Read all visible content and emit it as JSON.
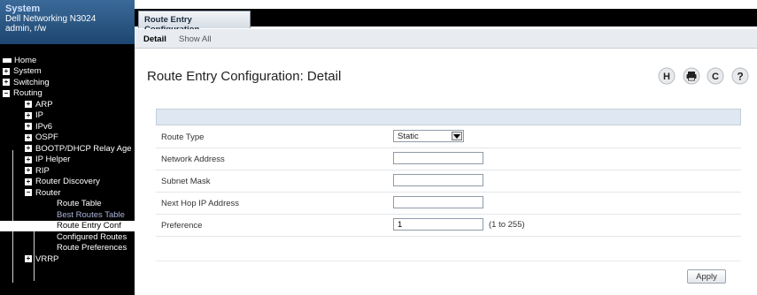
{
  "system": {
    "title": "System",
    "model": "Dell Networking N3024",
    "user": "admin, r/w"
  },
  "nav": {
    "items": [
      {
        "label": "Home",
        "toggle": "",
        "level": "lvl0",
        "icon": "home-icon",
        "state": ""
      },
      {
        "label": "System",
        "toggle": "+",
        "level": "lvl0",
        "icon": "expand-icon",
        "state": ""
      },
      {
        "label": "Switching",
        "toggle": "+",
        "level": "lvl0",
        "icon": "expand-icon",
        "state": ""
      },
      {
        "label": "Routing",
        "toggle": "−",
        "level": "lvl0",
        "icon": "collapse-icon",
        "state": ""
      },
      {
        "label": "ARP",
        "toggle": "+",
        "level": "lvl1",
        "icon": "expand-icon",
        "state": ""
      },
      {
        "label": "IP",
        "toggle": "+",
        "level": "lvl1",
        "icon": "expand-icon",
        "state": ""
      },
      {
        "label": "IPv6",
        "toggle": "+",
        "level": "lvl1",
        "icon": "expand-icon",
        "state": ""
      },
      {
        "label": "OSPF",
        "toggle": "+",
        "level": "lvl1",
        "icon": "expand-icon",
        "state": ""
      },
      {
        "label": "BOOTP/DHCP Relay Age",
        "toggle": "+",
        "level": "lvl1",
        "icon": "expand-icon",
        "state": ""
      },
      {
        "label": "IP Helper",
        "toggle": "+",
        "level": "lvl1",
        "icon": "expand-icon",
        "state": ""
      },
      {
        "label": "RIP",
        "toggle": "+",
        "level": "lvl1",
        "icon": "expand-icon",
        "state": ""
      },
      {
        "label": "Router Discovery",
        "toggle": "+",
        "level": "lvl1",
        "icon": "expand-icon",
        "state": ""
      },
      {
        "label": "Router",
        "toggle": "−",
        "level": "lvl1",
        "icon": "collapse-icon",
        "state": ""
      },
      {
        "label": "Route Table",
        "toggle": "",
        "level": "lvl2",
        "icon": "",
        "state": ""
      },
      {
        "label": "Best Routes Table",
        "toggle": "",
        "level": "lvl2",
        "icon": "",
        "state": "dim"
      },
      {
        "label": "Route Entry Conf",
        "toggle": "",
        "level": "lvl2",
        "icon": "",
        "state": "active"
      },
      {
        "label": "Configured Routes",
        "toggle": "",
        "level": "lvl2",
        "icon": "",
        "state": ""
      },
      {
        "label": "Route Preferences",
        "toggle": "",
        "level": "lvl2",
        "icon": "",
        "state": ""
      },
      {
        "label": "VRRP",
        "toggle": "+",
        "level": "lvl1",
        "icon": "expand-icon",
        "state": ""
      }
    ]
  },
  "tabs": {
    "main": "Route Entry Configuration",
    "sub": [
      "Detail",
      "Show All"
    ]
  },
  "page": {
    "title": "Route Entry Configuration: Detail"
  },
  "toolbar": {
    "icons": [
      "help-h-icon",
      "print-icon",
      "refresh-icon",
      "question-icon"
    ],
    "help_label": "H",
    "refresh_label": "C",
    "question_label": "?"
  },
  "form": {
    "route_type_label": "Route Type",
    "route_type_value": "Static",
    "network_address_label": "Network Address",
    "network_address_value": "",
    "subnet_mask_label": "Subnet Mask",
    "subnet_mask_value": "",
    "next_hop_label": "Next Hop IP Address",
    "next_hop_value": "",
    "preference_label": "Preference",
    "preference_value": "1",
    "preference_range": "(1 to 255)"
  },
  "actions": {
    "apply_label": "Apply"
  },
  "colors": {
    "header_blue": "#1d4670",
    "form_header": "#dfe8f2",
    "active_nav": "#ffffff"
  }
}
